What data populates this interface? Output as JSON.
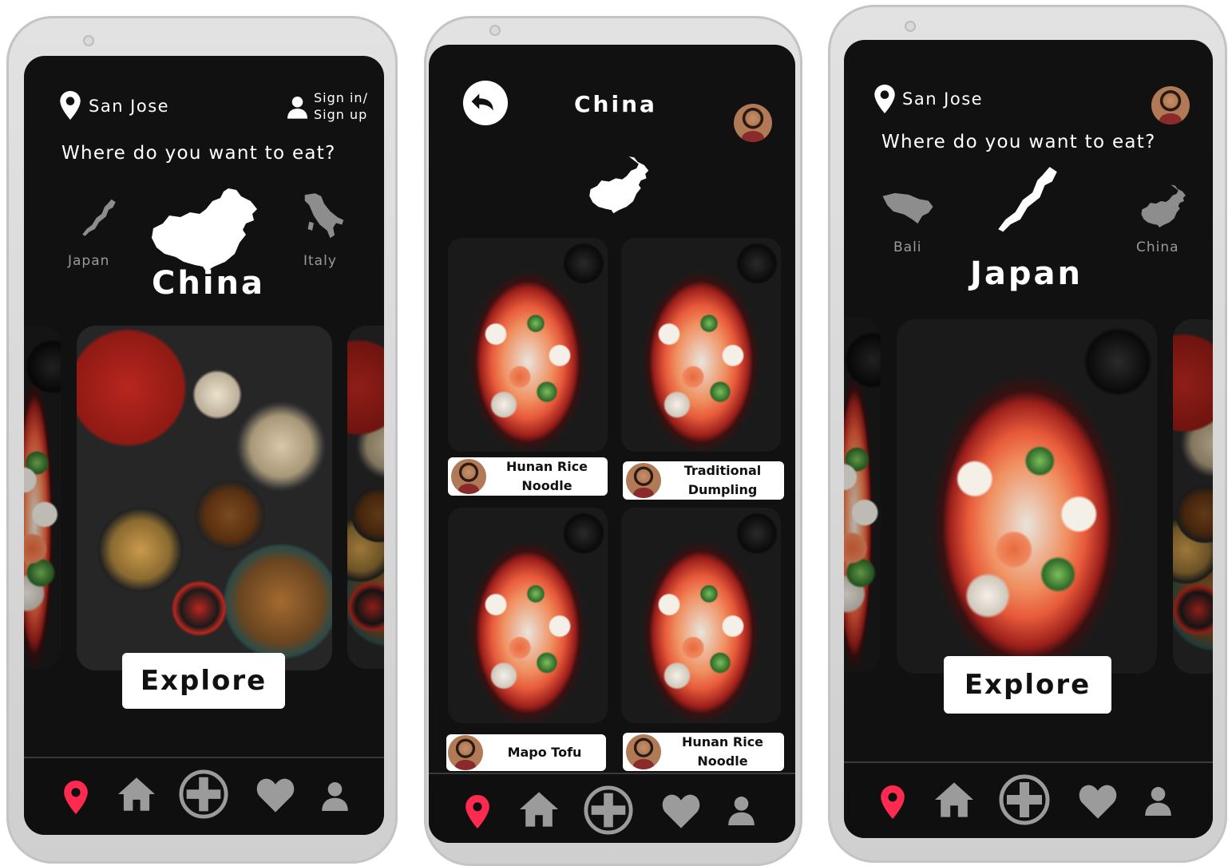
{
  "screen1": {
    "location": "San Jose",
    "sign_in": "Sign in/",
    "sign_up": "Sign up",
    "question": "Where do you want to eat?",
    "left_country": "Japan",
    "center_country": "China",
    "right_country": "Italy",
    "explore": "Explore"
  },
  "screen2": {
    "title": "China",
    "dishes": [
      {
        "name_line1": "Hunan Rice",
        "name_line2": "Noodle"
      },
      {
        "name_line1": "Traditional",
        "name_line2": "Dumpling"
      },
      {
        "name_line1": "Mapo Tofu",
        "name_line2": ""
      },
      {
        "name_line1": "Hunan Rice",
        "name_line2": "Noodle"
      }
    ]
  },
  "screen3": {
    "location": "San Jose",
    "question": "Where do you want to eat?",
    "left_country": "Bali",
    "center_country": "Japan",
    "right_country": "China",
    "explore": "Explore"
  },
  "nav_icons": [
    "location-pin-icon",
    "home-icon",
    "add-circle-icon",
    "heart-icon",
    "profile-icon"
  ],
  "colors": {
    "accent": "#ff2a4f",
    "background": "#111111",
    "inactive_icon": "#9b9b9b"
  }
}
